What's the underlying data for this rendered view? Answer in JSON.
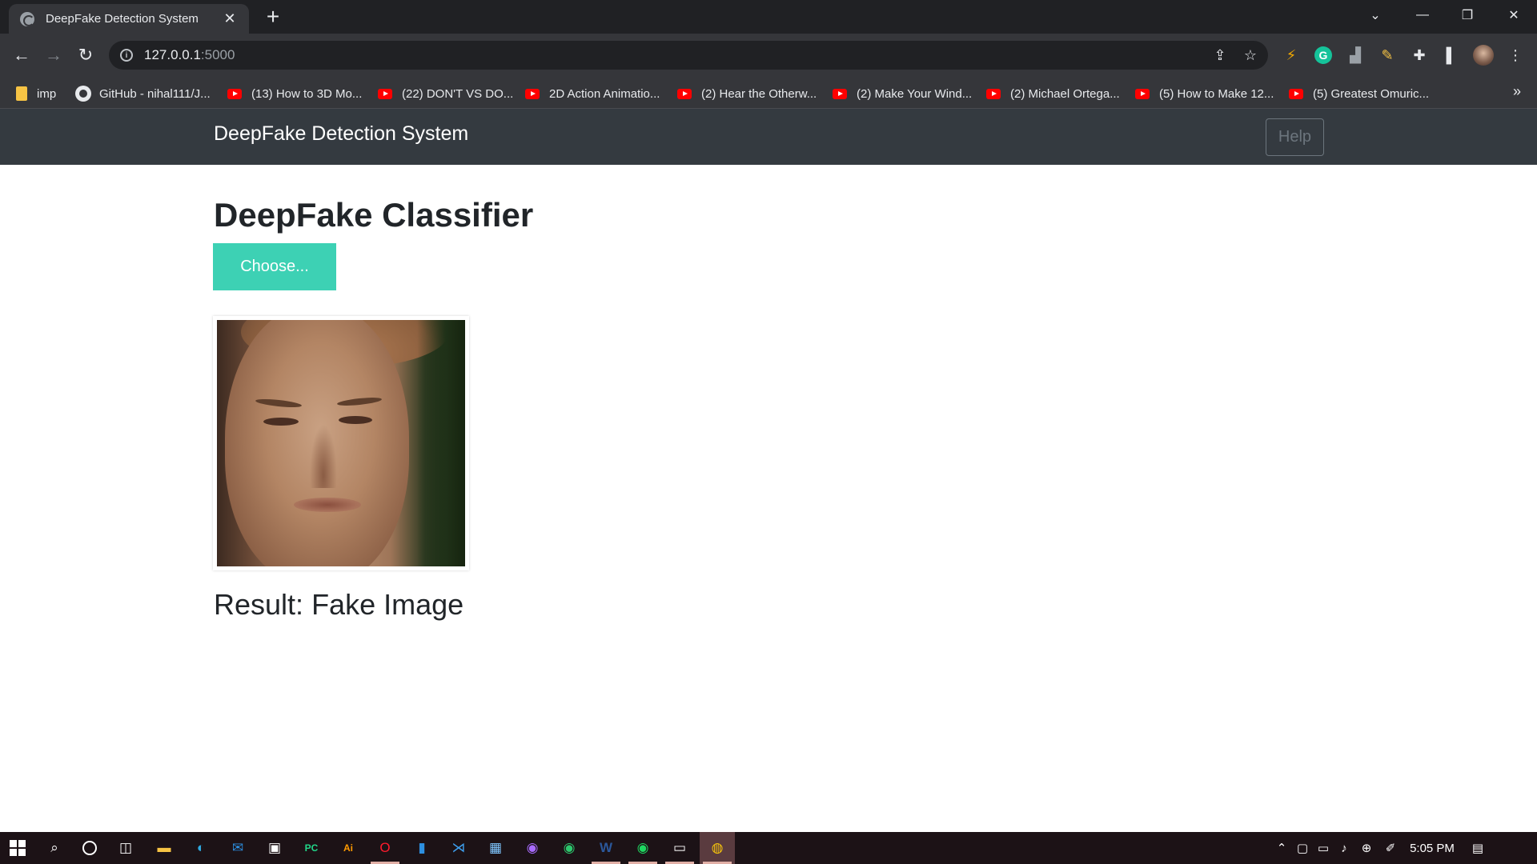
{
  "browser": {
    "tab_title": "DeepFake Detection System",
    "tab_close": "✕",
    "new_tab": "+",
    "window_controls": {
      "chevron": "⌄",
      "minimize": "—",
      "restore": "❐",
      "close": "✕"
    },
    "url_host": "127.0.0.1",
    "url_port": ":5000",
    "bookmarks": [
      {
        "label": "imp",
        "icon": "folder-icon"
      },
      {
        "label": "GitHub - nihal111/J...",
        "icon": "github-icon"
      },
      {
        "label": "(13) How to 3D Mo...",
        "icon": "youtube-icon"
      },
      {
        "label": "(22) DON'T VS DO...",
        "icon": "youtube-icon"
      },
      {
        "label": "2D Action Animatio...",
        "icon": "youtube-icon"
      },
      {
        "label": "(2) Hear the Otherw...",
        "icon": "youtube-icon"
      },
      {
        "label": "(2) Make Your Wind...",
        "icon": "youtube-icon"
      },
      {
        "label": "(2) Michael Ortega...",
        "icon": "youtube-icon"
      },
      {
        "label": "(5) How to Make 12...",
        "icon": "youtube-icon"
      },
      {
        "label": "(5) Greatest Omuric...",
        "icon": "youtube-icon"
      }
    ],
    "bookmarks_more": "»"
  },
  "site": {
    "brand": "DeepFake Detection System",
    "help_label": "Help"
  },
  "main": {
    "heading": "DeepFake Classifier",
    "choose_label": "Choose...",
    "result_label": "Result:",
    "result_value": "Fake Image"
  },
  "taskbar": {
    "time": "5:05 PM"
  },
  "colors": {
    "navbar_bg": "#343a40",
    "choose_btn": "#3dd1b4",
    "heading_text": "#212529",
    "taskbar_bg": "#1c1216"
  }
}
